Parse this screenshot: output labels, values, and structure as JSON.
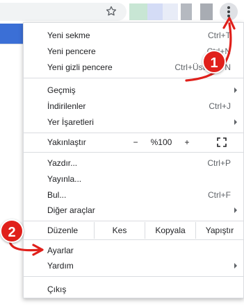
{
  "toolbar": {
    "icons": {
      "star": "star-icon",
      "menu": "kebab-menu-icon"
    },
    "ext_colors": [
      "#c8e6d4",
      "#d4dcf6",
      "#e8ecf7",
      "#b5b9c0",
      "#a8acb3"
    ]
  },
  "menu": {
    "new_tab": {
      "label": "Yeni sekme",
      "shortcut": "Ctrl+T"
    },
    "new_window": {
      "label": "Yeni pencere",
      "shortcut": "Ctrl+N"
    },
    "incognito": {
      "label": "Yeni gizli pencere",
      "shortcut": "Ctrl+ÜstKrkt+N"
    },
    "history": {
      "label": "Geçmiş"
    },
    "downloads": {
      "label": "İndirilenler",
      "shortcut": "Ctrl+J"
    },
    "bookmarks": {
      "label": "Yer İşaretleri"
    },
    "zoom": {
      "label": "Yakınlaştır",
      "minus": "−",
      "level": "%100",
      "plus": "+"
    },
    "print": {
      "label": "Yazdır...",
      "shortcut": "Ctrl+P"
    },
    "cast": {
      "label": "Yayınla..."
    },
    "find": {
      "label": "Bul...",
      "shortcut": "Ctrl+F"
    },
    "more_tools": {
      "label": "Diğer araçlar"
    },
    "edit": {
      "label": "Düzenle",
      "cut": "Kes",
      "copy": "Kopyala",
      "paste": "Yapıştır"
    },
    "settings": {
      "label": "Ayarlar"
    },
    "help": {
      "label": "Yardım"
    },
    "exit": {
      "label": "Çıkış"
    }
  },
  "annotations": {
    "step1": "1",
    "step2": "2",
    "color": "#e0201b"
  }
}
